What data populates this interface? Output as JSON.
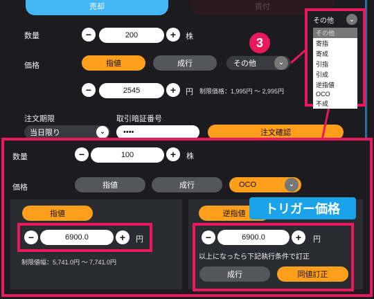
{
  "top_tabs": {
    "sell": "売却",
    "buy": "買付"
  },
  "step_marker": "3",
  "top_form": {
    "qty_label": "数量",
    "qty_value": "200",
    "qty_unit": "株",
    "price_label": "価格",
    "limit_btn": "指値",
    "market_btn": "成行",
    "other_select": "その他",
    "price_value": "2545",
    "price_unit": "円",
    "price_range": "制限価格：1,995円 ～ 2,995円",
    "period_label": "注文期限",
    "period_value": "当日限り",
    "pin_label": "取引暗証番号",
    "pin_value": "••••",
    "confirm_btn": "注文確認"
  },
  "dropdown": {
    "selected": "その他",
    "options": [
      "その他",
      "寄指",
      "寄成",
      "引指",
      "引成",
      "逆指値",
      "OCO",
      "不成"
    ]
  },
  "bottom_form": {
    "qty_label": "数量",
    "qty_value": "100",
    "qty_unit": "株",
    "price_label": "価格",
    "limit_btn": "指値",
    "market_btn": "成行",
    "oco_select": "OCO",
    "left_panel": {
      "tab": "指値",
      "value": "6900.0",
      "unit": "円",
      "range": "制限値幅：5,741.0円 ～ 7,741.0円"
    },
    "right_panel": {
      "tab": "逆指値",
      "value": "6900.0",
      "unit": "円",
      "condition": "以上になったら下記執行条件で訂正",
      "market_btn": "成行",
      "amend_btn": "同値訂正"
    },
    "trigger_label": "トリガー価格"
  },
  "colors": {
    "accent_pink": "#e8195c",
    "orange": "#ff9f1c",
    "blue": "#3fb4f5",
    "trigger_bg": "#1aa3e8"
  }
}
